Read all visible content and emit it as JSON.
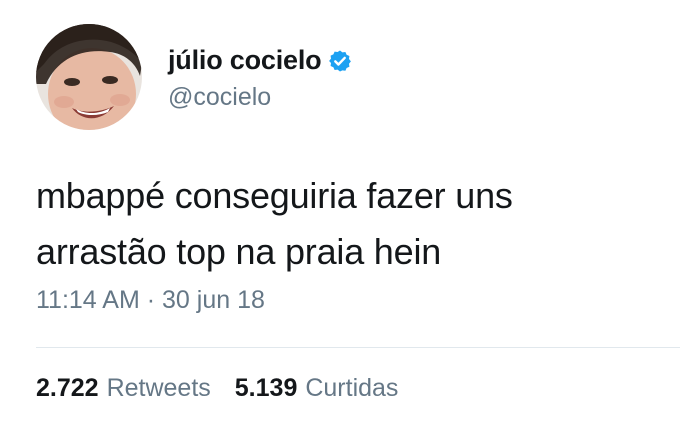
{
  "user": {
    "display_name": "júlio cocielo",
    "handle": "@cocielo",
    "verified": true,
    "verified_color": "#1da1f2",
    "avatar_icon": "profile-photo"
  },
  "tweet": {
    "lines": [
      "mbappé conseguiria fazer uns",
      "arrastão top na praia hein"
    ],
    "time": "11:14 AM",
    "separator": "·",
    "date": "30 jun 18"
  },
  "stats": {
    "retweets_count": "2.722",
    "retweets_label": "Retweets",
    "likes_count": "5.139",
    "likes_label": "Curtidas"
  }
}
